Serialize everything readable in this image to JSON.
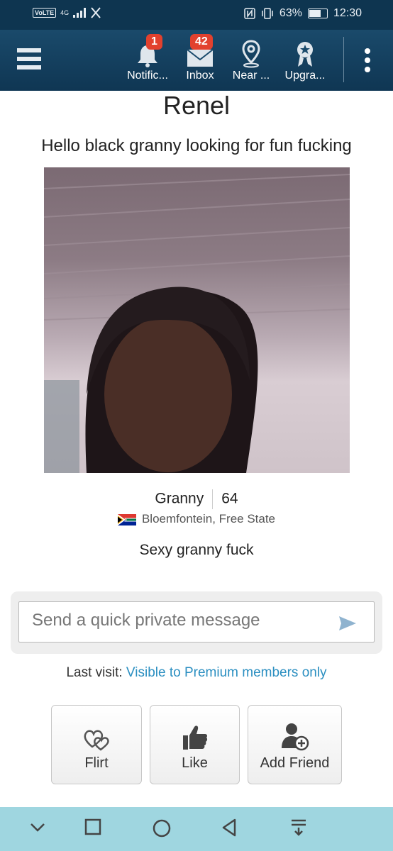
{
  "status_bar": {
    "volte": "VoLTE",
    "network": "4G",
    "battery_percent": "63%",
    "battery_level": 0.63,
    "time": "12:30"
  },
  "app_bar": {
    "nav": [
      {
        "label": "Notific...",
        "badge": "1",
        "icon": "bell-icon"
      },
      {
        "label": "Inbox",
        "badge": "42",
        "icon": "envelope-icon"
      },
      {
        "label": "Near ...",
        "badge": "",
        "icon": "location-pin-icon"
      },
      {
        "label": "Upgra...",
        "badge": "",
        "icon": "award-ribbon-icon"
      }
    ]
  },
  "profile": {
    "name": "Renel",
    "headline": "Hello black granny looking for fun fucking",
    "category": "Granny",
    "age": "64",
    "location": "Bloemfontein, Free State",
    "tagline": "Sexy granny fuck"
  },
  "message": {
    "placeholder": "Send a quick private message"
  },
  "last_visit": {
    "label": "Last visit:",
    "value": "Visible to Premium members only"
  },
  "actions": {
    "flirt": "Flirt",
    "like": "Like",
    "add_friend": "Add Friend"
  },
  "colors": {
    "app_bar": "#0f3653",
    "badge": "#e2412e",
    "link": "#2b8fc1",
    "system_nav": "#9fd6e0"
  }
}
